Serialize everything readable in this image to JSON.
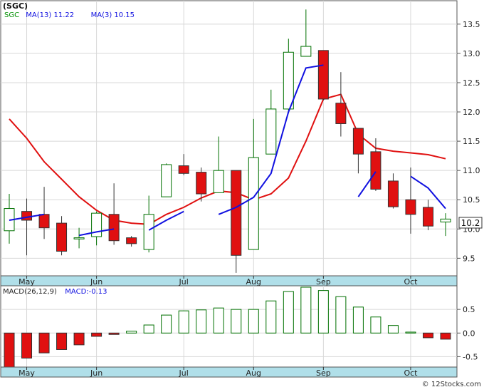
{
  "chart_data": [
    {
      "type": "candlestick",
      "title": "(SGC)",
      "indicators": [
        {
          "label": "SGC",
          "color": "#009000"
        },
        {
          "label": "MA(13)",
          "value": "11.22",
          "color": "#1010e0"
        },
        {
          "label": "MA(3)",
          "value": "10.15",
          "color": "#1010e0"
        }
      ],
      "current_price_label": "10.2",
      "y_ticks": [
        "13.5",
        "13.0",
        "12.5",
        "12.0",
        "11.5",
        "11.0",
        "10.5",
        "10.0",
        "9.5"
      ],
      "ylim": [
        9.2,
        13.9
      ],
      "x_tick_labels": [
        "May",
        "Jun",
        "Jul",
        "Aug",
        "Sep",
        "Oct"
      ],
      "candles": [
        {
          "o": 9.97,
          "h": 10.6,
          "l": 9.75,
          "c": 10.35
        },
        {
          "o": 10.3,
          "h": 10.52,
          "l": 9.55,
          "c": 10.15
        },
        {
          "o": 10.25,
          "h": 10.72,
          "l": 9.83,
          "c": 10.02
        },
        {
          "o": 10.1,
          "h": 10.22,
          "l": 9.55,
          "c": 9.62
        },
        {
          "o": 9.83,
          "h": 10.02,
          "l": 9.67,
          "c": 9.85
        },
        {
          "o": 9.87,
          "h": 10.3,
          "l": 9.72,
          "c": 10.27
        },
        {
          "o": 10.25,
          "h": 10.78,
          "l": 9.73,
          "c": 9.8
        },
        {
          "o": 9.85,
          "h": 9.88,
          "l": 9.7,
          "c": 9.75
        },
        {
          "o": 9.65,
          "h": 10.57,
          "l": 9.6,
          "c": 10.25
        },
        {
          "o": 10.55,
          "h": 11.12,
          "l": 10.55,
          "c": 11.1
        },
        {
          "o": 11.08,
          "h": 11.28,
          "l": 10.92,
          "c": 10.95
        },
        {
          "o": 10.97,
          "h": 11.05,
          "l": 10.47,
          "c": 10.6
        },
        {
          "o": 10.62,
          "h": 11.58,
          "l": 10.62,
          "c": 11.0
        },
        {
          "o": 11.0,
          "h": 11.0,
          "l": 9.25,
          "c": 9.55
        },
        {
          "o": 9.65,
          "h": 11.88,
          "l": 9.65,
          "c": 11.22
        },
        {
          "o": 11.28,
          "h": 12.38,
          "l": 11.28,
          "c": 12.05
        },
        {
          "o": 12.05,
          "h": 13.25,
          "l": 11.98,
          "c": 13.02
        },
        {
          "o": 12.95,
          "h": 13.75,
          "l": 12.95,
          "c": 13.12
        },
        {
          "o": 13.05,
          "h": 13.05,
          "l": 12.2,
          "c": 12.22
        },
        {
          "o": 12.15,
          "h": 12.68,
          "l": 11.58,
          "c": 11.8
        },
        {
          "o": 11.72,
          "h": 11.72,
          "l": 10.95,
          "c": 11.28
        },
        {
          "o": 11.32,
          "h": 11.55,
          "l": 10.65,
          "c": 10.68
        },
        {
          "o": 10.82,
          "h": 10.95,
          "l": 10.35,
          "c": 10.38
        },
        {
          "o": 10.5,
          "h": 11.05,
          "l": 9.92,
          "c": 10.25
        },
        {
          "o": 10.37,
          "h": 10.5,
          "l": 9.98,
          "c": 10.05
        },
        {
          "o": 10.12,
          "h": 10.27,
          "l": 9.88,
          "c": 10.17
        }
      ],
      "series": [
        {
          "name": "MA(13)",
          "color": "#e01010",
          "values": [
            11.88,
            11.55,
            11.15,
            10.85,
            10.55,
            10.32,
            10.15,
            10.1,
            10.08,
            10.25,
            10.37,
            10.53,
            10.65,
            10.62,
            10.5,
            10.6,
            10.87,
            11.5,
            12.22,
            12.3,
            11.62,
            11.38,
            11.33,
            11.3,
            11.27,
            11.2
          ]
        },
        {
          "name": "MA(3)",
          "color": "#1010e0",
          "values": [
            10.15,
            10.2,
            10.25,
            null,
            9.89,
            9.95,
            10.0,
            null,
            9.98,
            10.15,
            10.3,
            null,
            10.25,
            10.37,
            10.54,
            10.95,
            12.0,
            12.75,
            12.8,
            null,
            10.55,
            10.98,
            null,
            10.9,
            10.7,
            10.35
          ]
        }
      ]
    },
    {
      "type": "bar",
      "title": "MACD(26,12,9)",
      "indicators": [
        {
          "label": "MACD(26,12,9)",
          "color": "#222222"
        },
        {
          "label": "MACD:-0.13",
          "color": "#1010e0"
        }
      ],
      "y_ticks": [
        "0.5",
        "0.0",
        "-0.5"
      ],
      "ylim": [
        -0.72,
        1.0
      ],
      "x_tick_labels": [
        "May",
        "Jun",
        "Jul",
        "Aug",
        "Sep",
        "Oct"
      ],
      "values": [
        -0.72,
        -0.53,
        -0.42,
        -0.35,
        -0.25,
        -0.07,
        -0.03,
        0.04,
        0.17,
        0.38,
        0.47,
        0.49,
        0.53,
        0.5,
        0.5,
        0.68,
        0.88,
        0.97,
        0.9,
        0.77,
        0.55,
        0.34,
        0.16,
        0.02,
        -0.1,
        -0.13
      ]
    }
  ],
  "footer": {
    "copyright": "© 12Stocks.com"
  },
  "colors": {
    "axis_band": "#b0dfe9",
    "grid": "#d8d8d8",
    "up": "#007000",
    "down": "#e01010"
  }
}
